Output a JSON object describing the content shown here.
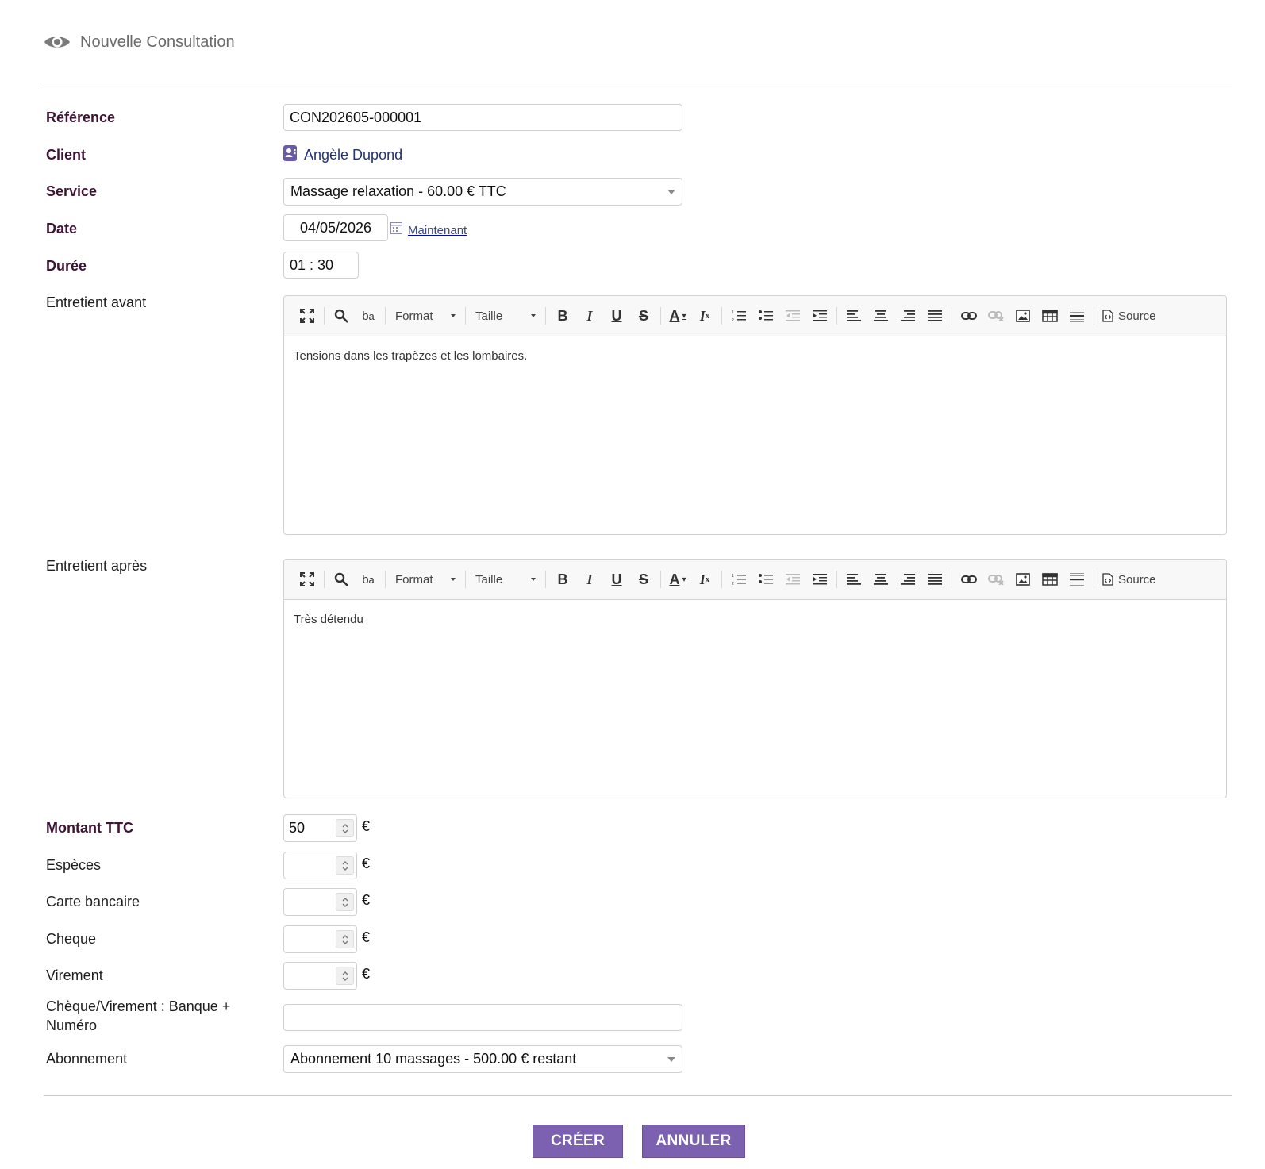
{
  "header": {
    "title": "Nouvelle Consultation",
    "icon": "eye-icon"
  },
  "form": {
    "reference": {
      "label": "Référence",
      "value": "CON202605-000001"
    },
    "client": {
      "label": "Client",
      "value": "Angèle Dupond",
      "icon": "contact-card-icon"
    },
    "service": {
      "label": "Service",
      "value": "Massage relaxation - 60.00 € TTC"
    },
    "date": {
      "label": "Date",
      "value": "04/05/2026",
      "now_label": "Maintenant"
    },
    "duration": {
      "label": "Durée",
      "value": "01 : 30"
    },
    "notes_before": {
      "label": "Entretient avant",
      "content": "Tensions dans les trapèzes et les lombaires."
    },
    "notes_after": {
      "label": "Entretient après",
      "content": "Très détendu"
    },
    "amount_ttc": {
      "label": "Montant TTC",
      "value": "50",
      "currency": "€"
    },
    "cash": {
      "label": "Espèces",
      "value": "",
      "currency": "€"
    },
    "card": {
      "label": "Carte bancaire",
      "value": "",
      "currency": "€"
    },
    "cheque": {
      "label": "Cheque",
      "value": "",
      "currency": "€"
    },
    "transfer": {
      "label": "Virement",
      "value": "",
      "currency": "€"
    },
    "bank_number": {
      "label": "Chèque/Virement : Banque + Numéro",
      "value": ""
    },
    "subscription": {
      "label": "Abonnement",
      "value": "Abonnement 10 massages - 500.00 € restant"
    }
  },
  "editor_toolbar": {
    "format_label": "Format",
    "size_label": "Taille",
    "source_label": "Source"
  },
  "actions": {
    "create_label": "CRÉER",
    "cancel_label": "ANNULER"
  },
  "colors": {
    "label_required": "#3d1434",
    "link": "#25326e",
    "button_bg": "#7b61b0"
  }
}
